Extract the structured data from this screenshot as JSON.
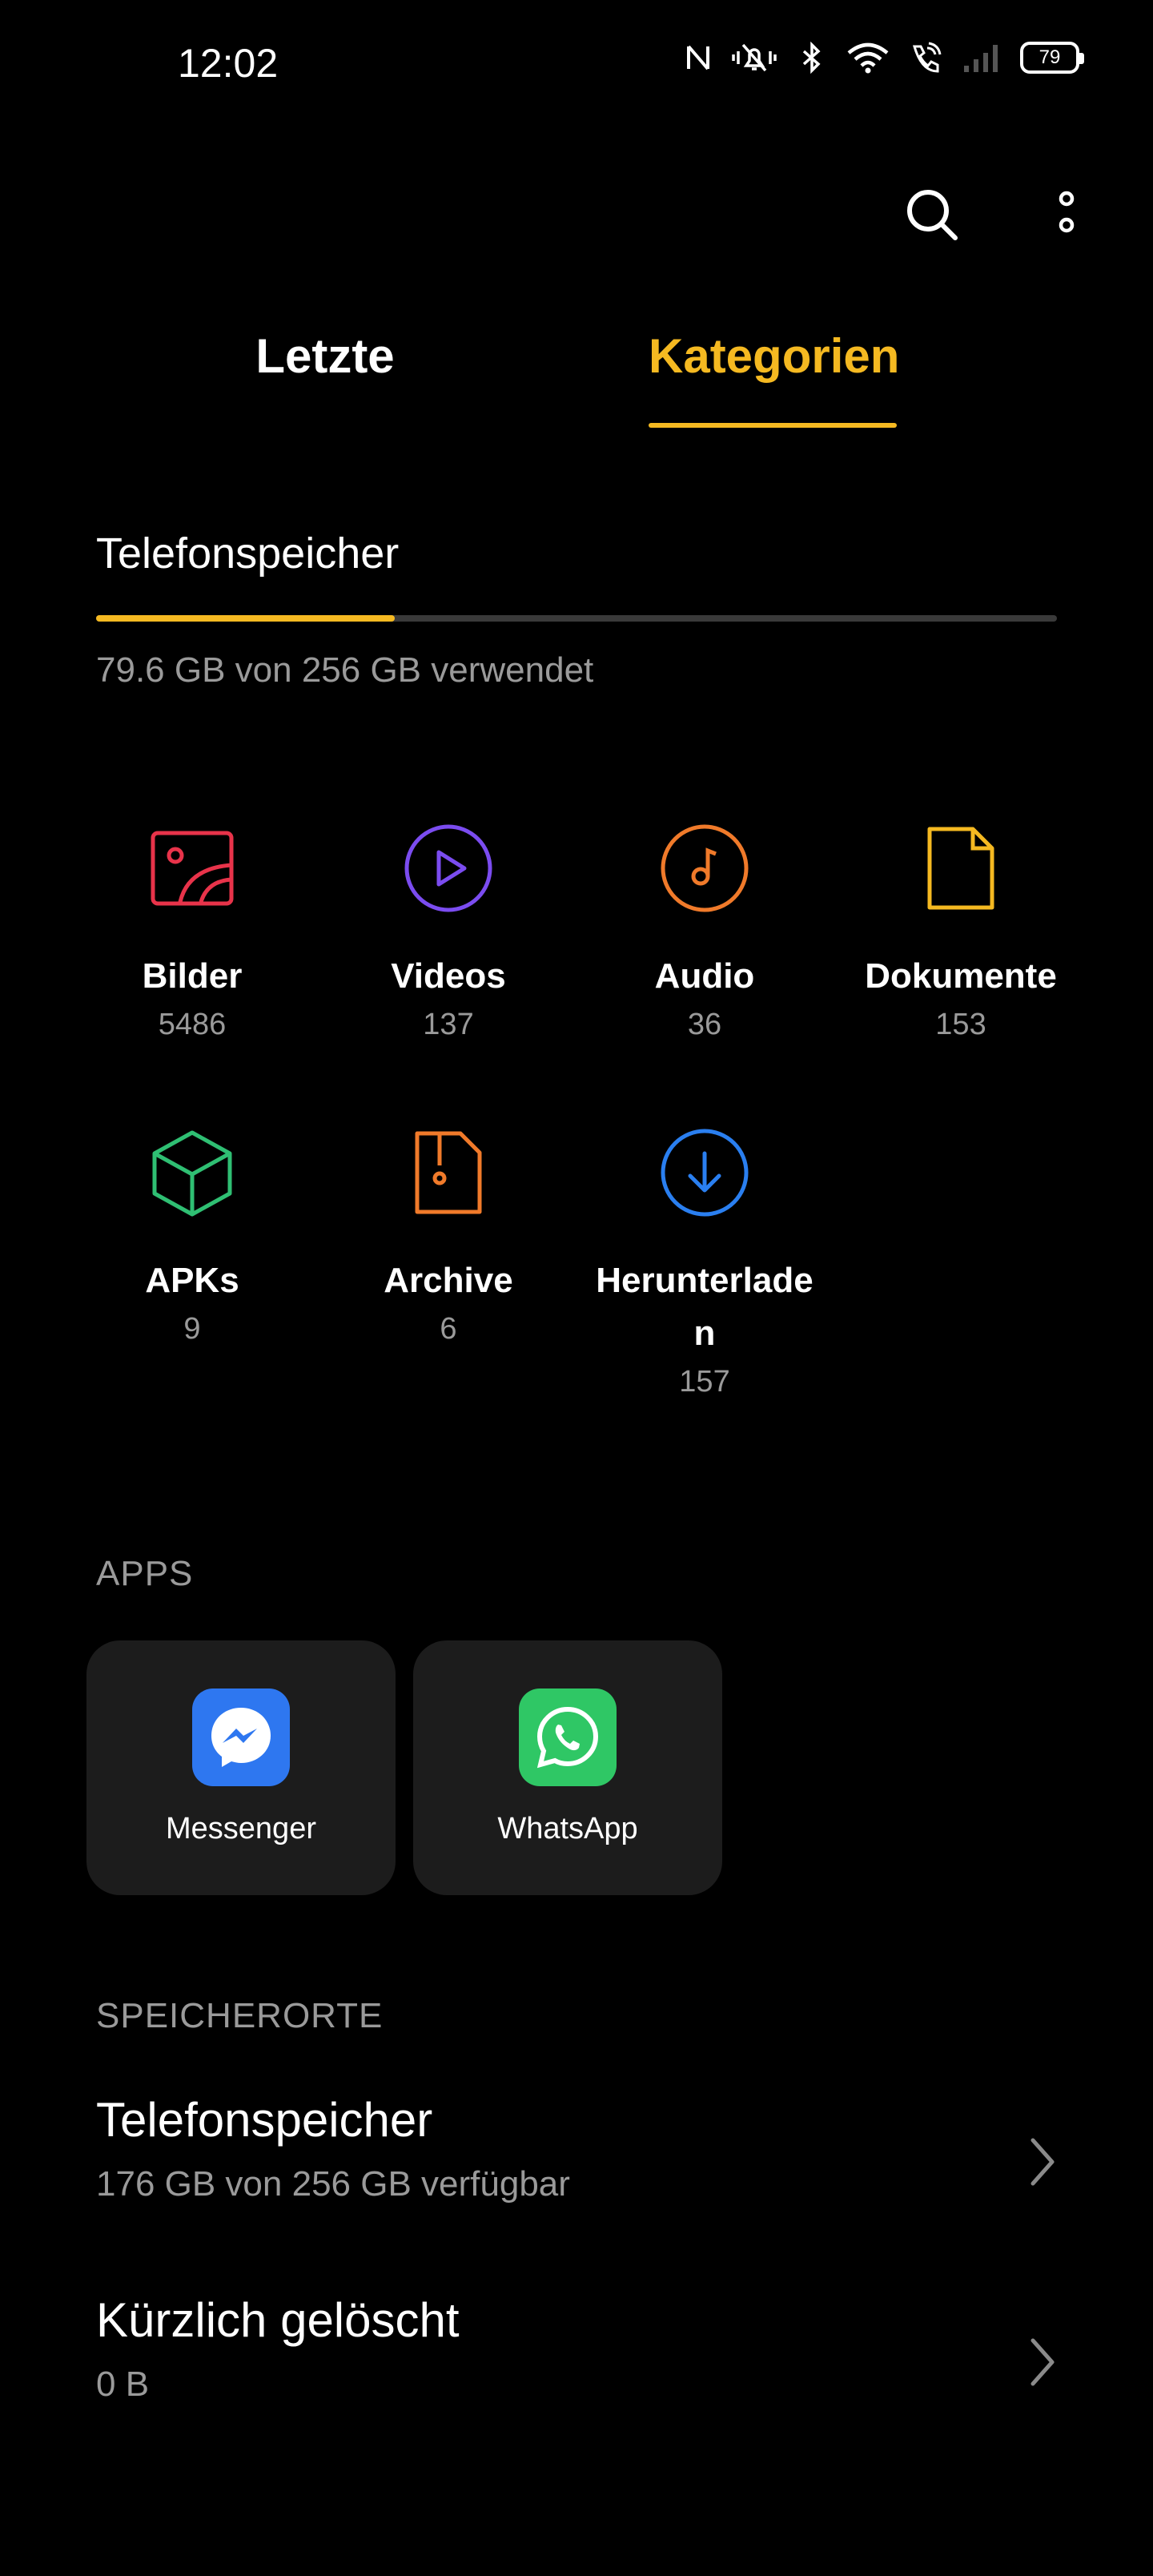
{
  "status": {
    "time": "12:02",
    "battery": "79"
  },
  "tabs": [
    {
      "label": "Letzte",
      "active": false
    },
    {
      "label": "Kategorien",
      "active": true
    }
  ],
  "storage": {
    "title": "Telefonspeicher",
    "used_text": "79.6 GB von 256 GB verwendet",
    "used_fraction": 0.311
  },
  "categories": [
    {
      "label": "Bilder",
      "count": "5486",
      "icon": "image-icon",
      "color": "#e8334a"
    },
    {
      "label": "Videos",
      "count": "137",
      "icon": "play-circle-icon",
      "color": "#7b4cf0"
    },
    {
      "label": "Audio",
      "count": "36",
      "icon": "music-note-icon",
      "color": "#f07a2a"
    },
    {
      "label": "Dokumente",
      "count": "153",
      "icon": "document-icon",
      "color": "#f5b921"
    },
    {
      "label": "APKs",
      "count": "9",
      "icon": "package-cube-icon",
      "color": "#2fbf73"
    },
    {
      "label": "Archive",
      "count": "6",
      "icon": "archive-file-icon",
      "color": "#f07a2a"
    },
    {
      "label": "Herunterlade\nn",
      "count": "157",
      "icon": "download-circle-icon",
      "color": "#2a7ff0"
    }
  ],
  "apps_section": {
    "title": "APPS",
    "apps": [
      {
        "label": "Messenger",
        "icon": "messenger-icon",
        "color": "#2e77f0"
      },
      {
        "label": "WhatsApp",
        "icon": "whatsapp-icon",
        "color": "#2fc765"
      }
    ]
  },
  "locations_section": {
    "title": "SPEICHERORTE",
    "items": [
      {
        "title": "Telefonspeicher",
        "subtitle": "176 GB von 256 GB verfügbar"
      },
      {
        "title": "Kürzlich gelöscht",
        "subtitle": "0 B"
      }
    ]
  }
}
